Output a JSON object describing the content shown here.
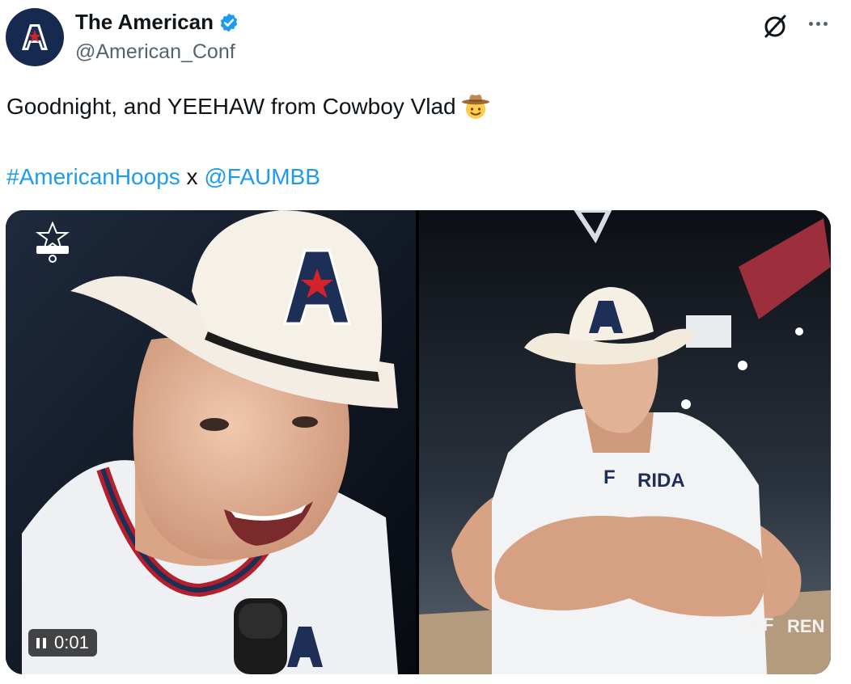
{
  "author": {
    "display_name": "The American",
    "handle": "@American_Conf",
    "avatar_icon": "american-conference-logo-icon",
    "verified_icon": "verified-badge-icon",
    "brand_color": "#152a4e",
    "verified_color": "#1d9bf0"
  },
  "header_actions": {
    "grok_icon": "grok-icon",
    "more_icon": "more-options-icon"
  },
  "tweet": {
    "text": "Goodnight, and YEEHAW from Cowboy Vlad",
    "emoji": "cowboy-hat-face-icon",
    "hashtag": "#AmericanHoops",
    "separator": " x ",
    "mention": "@FAUMBB",
    "link_color": "#1d9bf0"
  },
  "media": {
    "video": {
      "status_icon": "pause-icon",
      "elapsed_time": "0:01",
      "overlay_logo": "championships-logo-icon",
      "description": "player in cowboy hat interview"
    },
    "photo": {
      "description": "player in cowboy hat arms crossed in arena"
    }
  }
}
